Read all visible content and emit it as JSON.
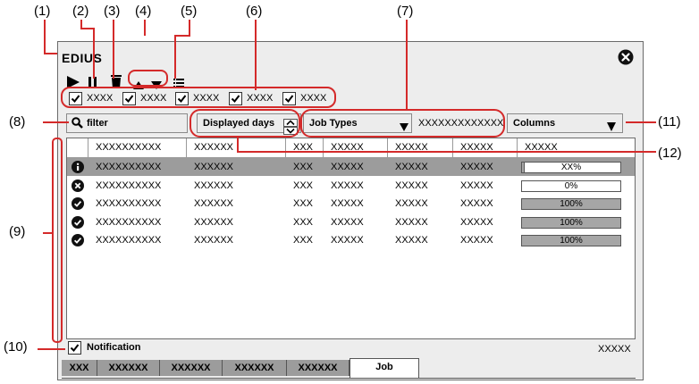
{
  "callouts": [
    "(1)",
    "(2)",
    "(3)",
    "(4)",
    "(5)",
    "(6)",
    "(7)",
    "(8)",
    "(9)",
    "(10)",
    "(11)",
    "(12)"
  ],
  "window": {
    "title": "EDIUS"
  },
  "filters": [
    {
      "label": "XXXX",
      "checked": true
    },
    {
      "label": "XXXX",
      "checked": true
    },
    {
      "label": "XXXX",
      "checked": true
    },
    {
      "label": "XXXX",
      "checked": true
    },
    {
      "label": "XXXX",
      "checked": true
    }
  ],
  "search": {
    "placeholder": "filter"
  },
  "displayed_days": {
    "label": "Displayed days"
  },
  "job_types": {
    "label": "Job Types"
  },
  "job_types_value": "XXXXXXXXXXXXX",
  "columns": {
    "label": "Columns"
  },
  "table": {
    "headers": [
      "XXXXXXXXXX",
      "XXXXXX",
      "XXX",
      "XXXXX",
      "XXXXX",
      "XXXXX",
      "XXXXX"
    ],
    "rows": [
      {
        "status": "info",
        "cells": [
          "XXXXXXXXXX",
          "XXXXXX",
          "XXX",
          "XXXXX",
          "XXXXX",
          "XXXXX"
        ],
        "progress_label": "XX%",
        "progress": 0.02,
        "selected": true
      },
      {
        "status": "error",
        "cells": [
          "XXXXXXXXXX",
          "XXXXXX",
          "XXX",
          "XXXXX",
          "XXXXX",
          "XXXXX"
        ],
        "progress_label": "0%",
        "progress": 0,
        "selected": false
      },
      {
        "status": "done",
        "cells": [
          "XXXXXXXXXX",
          "XXXXXX",
          "XXX",
          "XXXXX",
          "XXXXX",
          "XXXXX"
        ],
        "progress_label": "100%",
        "progress": 1,
        "selected": false
      },
      {
        "status": "done",
        "cells": [
          "XXXXXXXXXX",
          "XXXXXX",
          "XXX",
          "XXXXX",
          "XXXXX",
          "XXXXX"
        ],
        "progress_label": "100%",
        "progress": 1,
        "selected": false
      },
      {
        "status": "done",
        "cells": [
          "XXXXXXXXXX",
          "XXXXXX",
          "XXX",
          "XXXXX",
          "XXXXX",
          "XXXXX"
        ],
        "progress_label": "100%",
        "progress": 1,
        "selected": false
      }
    ]
  },
  "notification": {
    "label": "Notification",
    "checked": true
  },
  "status_right": "XXXXX",
  "tabs": [
    "XXX",
    "XXXXXX",
    "XXXXXX",
    "XXXXXX",
    "XXXXXX",
    "Job"
  ],
  "colors": {
    "callout_line": "#d42a2a",
    "selected_row": "#9c9c9c",
    "bar_fill": "#a6a6a6"
  },
  "icons": [
    "play-icon",
    "pause-icon",
    "delete-icon",
    "move-up-icon",
    "move-down-icon",
    "list-icon",
    "close-icon",
    "search-icon",
    "spin-up-icon",
    "spin-down-icon",
    "dropdown-arrow-icon",
    "info-icon",
    "error-icon",
    "check-circle-icon"
  ]
}
